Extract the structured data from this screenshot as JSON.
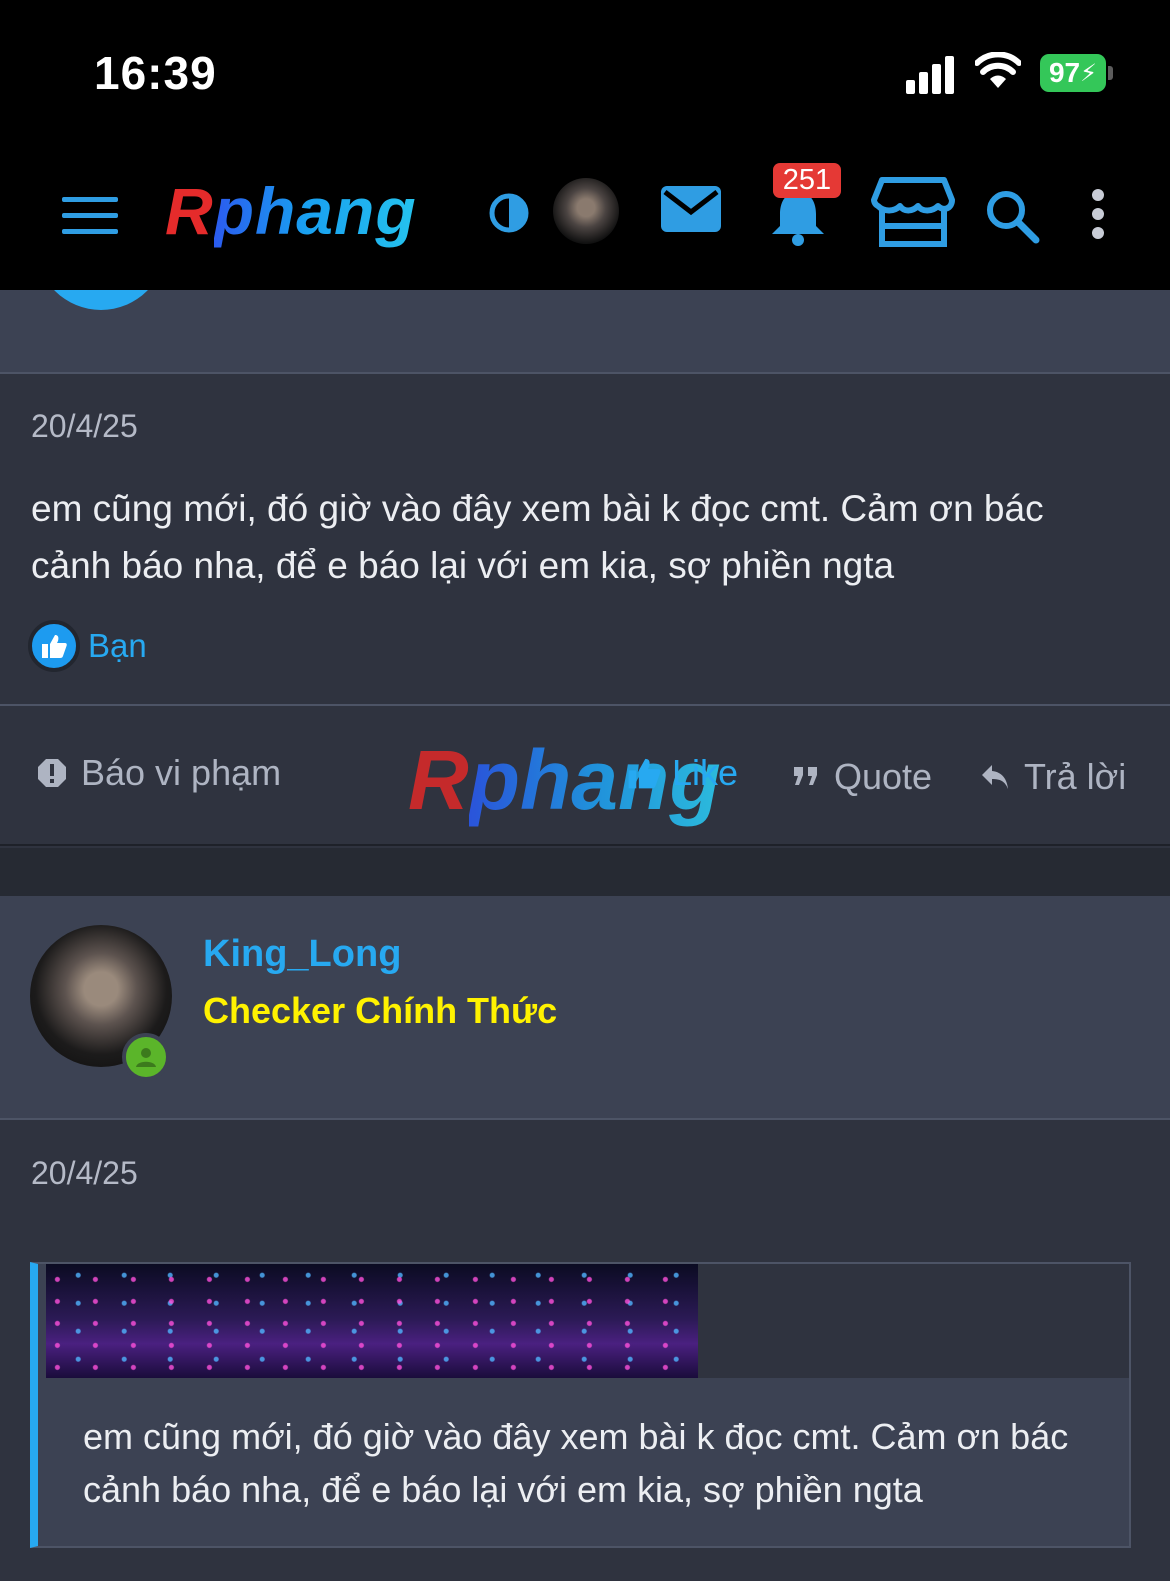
{
  "status_bar": {
    "time": "16:39",
    "battery": "97"
  },
  "header": {
    "logo_r": "R",
    "logo_rest": "phang",
    "notification_count": "251"
  },
  "post1": {
    "date": "20/4/25",
    "text": "em cũng mới, đó giờ vào đây xem bài k đọc cmt. Cảm ơn bác cảnh báo nha, để e báo lại với em kia, sợ phiền ngta",
    "reaction_label": "Bạn"
  },
  "actions": {
    "report": "Báo vi phạm",
    "like": "Like",
    "quote": "Quote",
    "reply": "Trả lời"
  },
  "watermark": {
    "r": "R",
    "rest": "phang"
  },
  "post2": {
    "username": "King_Long",
    "user_title": "Checker Chính Thức",
    "date": "20/4/25",
    "quote_text": "em cũng mới, đó giờ vào đây xem bài k đọc cmt. Cảm ơn bác cảnh báo nha, để e báo lại với em kia, sợ phiền ngta"
  },
  "colors": {
    "accent": "#27a9f1",
    "user_title": "#fff200",
    "online": "#5bb52a",
    "badge": "#e53935"
  }
}
